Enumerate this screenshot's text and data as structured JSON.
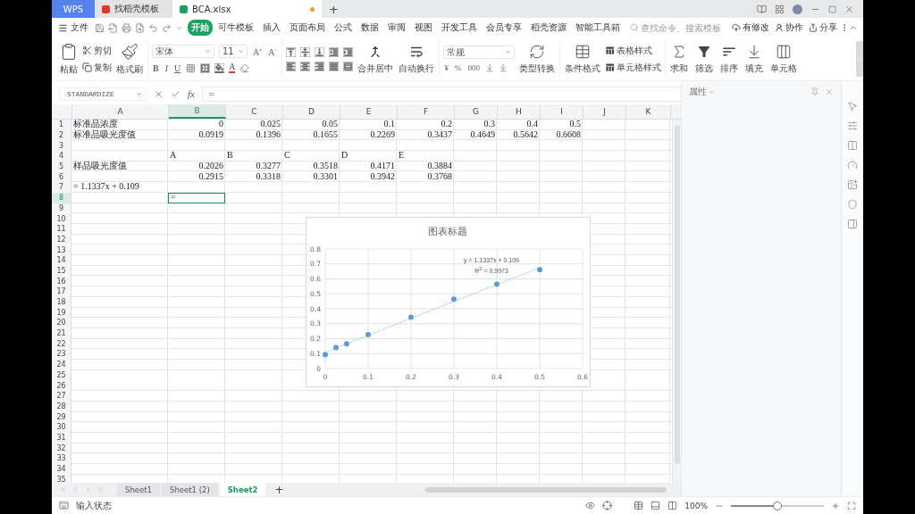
{
  "title_bar": {
    "tabs": [
      {
        "label": "WPS",
        "kind": "home",
        "selected": false,
        "modified": false
      },
      {
        "label": "找稻壳模板",
        "kind": "template",
        "selected": false,
        "modified": false
      },
      {
        "label": "BCA.xlsx",
        "kind": "workbook",
        "selected": true,
        "modified": true
      }
    ],
    "new_tab": "+"
  },
  "menu_bar": {
    "file": "文件",
    "tabs": [
      {
        "label": "开始",
        "selected": true
      },
      {
        "label": "可牛模板",
        "selected": false
      },
      {
        "label": "插入",
        "selected": false
      },
      {
        "label": "页面布局",
        "selected": false
      },
      {
        "label": "公式",
        "selected": false
      },
      {
        "label": "数据",
        "selected": false
      },
      {
        "label": "审阅",
        "selected": false
      },
      {
        "label": "视图",
        "selected": false
      },
      {
        "label": "开发工具",
        "selected": false
      },
      {
        "label": "会员专享",
        "selected": false
      },
      {
        "label": "稻壳资源",
        "selected": false
      },
      {
        "label": "智能工具箱",
        "selected": false
      }
    ],
    "search": {
      "placeholder": "查找命令、搜索模板"
    },
    "actions": [
      {
        "label": "有修改"
      },
      {
        "label": "协作"
      },
      {
        "label": "分享"
      }
    ]
  },
  "ribbon": {
    "paste": "粘贴",
    "cut": "剪切",
    "copy": "复制",
    "format_painter": "格式刷",
    "font_name": "宋体",
    "font_size": "11",
    "size_buttons": [
      "A⁺",
      "A⁻"
    ],
    "styles": [
      "B",
      "I",
      "U"
    ],
    "font_color": "A",
    "merge": "合并居中",
    "wrap": "自动换行",
    "number_format": "常规",
    "number_symbols": [
      "¥",
      "%",
      "000"
    ],
    "convert": "类型转换",
    "conditional_format": "条件格式",
    "table_style": "表格样式",
    "cell_style": "单元格样式",
    "sum": "求和",
    "filter": "筛选",
    "sort": "排序",
    "fill": "填充",
    "cell": "单元格"
  },
  "formula_bar": {
    "name_box": "STANDARDIZE",
    "fx": "fx",
    "value": "="
  },
  "sheet": {
    "columns": [
      {
        "label": "A",
        "selected": false
      },
      {
        "label": "B",
        "selected": true
      },
      {
        "label": "C",
        "selected": false
      },
      {
        "label": "D",
        "selected": false
      },
      {
        "label": "E",
        "selected": false
      },
      {
        "label": "F",
        "selected": false
      },
      {
        "label": "G",
        "selected": false
      },
      {
        "label": "H",
        "selected": false
      },
      {
        "label": "I",
        "selected": false
      },
      {
        "label": "J",
        "selected": false
      },
      {
        "label": "K",
        "selected": false
      }
    ],
    "rows": [
      {
        "label": "1",
        "selected": false,
        "cells": {
          "A": {
            "kind": "text",
            "text": "标准品浓度"
          },
          "B": {
            "kind": "number",
            "text": "0"
          },
          "C": {
            "kind": "number",
            "text": "0.025"
          },
          "D": {
            "kind": "number",
            "text": "0.05"
          },
          "E": {
            "kind": "number",
            "text": "0.1"
          },
          "F": {
            "kind": "number",
            "text": "0.2"
          },
          "G": {
            "kind": "number",
            "text": "0.3"
          },
          "H": {
            "kind": "number",
            "text": "0.4"
          },
          "I": {
            "kind": "number",
            "text": "0.5"
          }
        }
      },
      {
        "label": "2",
        "selected": false,
        "cells": {
          "A": {
            "kind": "text",
            "text": "标准品吸光度值"
          },
          "B": {
            "kind": "number",
            "text": "0.0919"
          },
          "C": {
            "kind": "number",
            "text": "0.1396"
          },
          "D": {
            "kind": "number",
            "text": "0.1655"
          },
          "E": {
            "kind": "number",
            "text": "0.2269"
          },
          "F": {
            "kind": "number",
            "text": "0.3437"
          },
          "G": {
            "kind": "number",
            "text": "0.4649"
          },
          "H": {
            "kind": "number",
            "text": "0.5642"
          },
          "I": {
            "kind": "number",
            "text": "0.6608"
          }
        }
      },
      {
        "label": "3",
        "selected": false
      },
      {
        "label": "4",
        "selected": false,
        "cells": {
          "B": {
            "kind": "text",
            "text": "A"
          },
          "C": {
            "kind": "text",
            "text": "B"
          },
          "D": {
            "kind": "text",
            "text": "C"
          },
          "E": {
            "kind": "text",
            "text": "D"
          },
          "F": {
            "kind": "text",
            "text": "E"
          }
        }
      },
      {
        "label": "5",
        "selected": false,
        "cells": {
          "A": {
            "kind": "text",
            "text": "样品吸光度值"
          },
          "B": {
            "kind": "number",
            "text": "0.2026"
          },
          "C": {
            "kind": "number",
            "text": "0.3277"
          },
          "D": {
            "kind": "number",
            "text": "0.3518"
          },
          "E": {
            "kind": "number",
            "text": "0.4171"
          },
          "F": {
            "kind": "number",
            "text": "0.3884"
          }
        }
      },
      {
        "label": "6",
        "selected": false,
        "cells": {
          "B": {
            "kind": "number",
            "text": "0.2915"
          },
          "C": {
            "kind": "number",
            "text": "0.3318"
          },
          "D": {
            "kind": "number",
            "text": "0.3301"
          },
          "E": {
            "kind": "number",
            "text": "0.3942"
          },
          "F": {
            "kind": "number",
            "text": "0.3768"
          }
        }
      },
      {
        "label": "7",
        "selected": false,
        "cells": {
          "A": {
            "kind": "text",
            "text": "= 1.1337x + 0.109"
          }
        }
      },
      {
        "label": "8",
        "selected": true,
        "cells": {
          "B": {
            "kind": "editing",
            "text": "="
          }
        }
      },
      {
        "label": "9",
        "selected": false
      },
      {
        "label": "10",
        "selected": false
      },
      {
        "label": "11",
        "selected": false
      },
      {
        "label": "12",
        "selected": false
      },
      {
        "label": "13",
        "selected": false
      },
      {
        "label": "14",
        "selected": false
      },
      {
        "label": "15",
        "selected": false
      },
      {
        "label": "16",
        "selected": false
      },
      {
        "label": "17",
        "selected": false
      },
      {
        "label": "18",
        "selected": false
      },
      {
        "label": "19",
        "selected": false
      },
      {
        "label": "20",
        "selected": false
      },
      {
        "label": "21",
        "selected": false
      },
      {
        "label": "22",
        "selected": false
      },
      {
        "label": "23",
        "selected": false
      },
      {
        "label": "24",
        "selected": false
      },
      {
        "label": "25",
        "selected": false
      },
      {
        "label": "26",
        "selected": false
      },
      {
        "label": "27",
        "selected": false
      },
      {
        "label": "28",
        "selected": false
      },
      {
        "label": "29",
        "selected": false
      },
      {
        "label": "30",
        "selected": false
      },
      {
        "label": "31",
        "selected": false
      },
      {
        "label": "32",
        "selected": false
      },
      {
        "label": "33",
        "selected": false
      },
      {
        "label": "34",
        "selected": false
      },
      {
        "label": "35",
        "selected": false
      }
    ]
  },
  "chart": {
    "chart_data": {
      "type": "scatter",
      "title": "图表标题",
      "x": [
        0,
        0.025,
        0.05,
        0.1,
        0.2,
        0.3,
        0.4,
        0.5
      ],
      "series": [
        {
          "color": "#5b9bd5",
          "values": [
            0.0919,
            0.1396,
            0.1655,
            0.2269,
            0.3437,
            0.4649,
            0.5642,
            0.6608
          ]
        },
        {
          "type": "line",
          "line_style": "dotted",
          "color": "#7fb0da",
          "values": [
            0.109,
            0.137,
            0.166,
            0.222,
            0.336,
            0.449,
            0.562,
            0.676
          ]
        }
      ],
      "grid": true,
      "xlim": [
        0,
        0.6
      ],
      "ylim": [
        0,
        0.8
      ],
      "xticks": [
        0,
        0.1,
        0.2,
        0.3,
        0.4,
        0.5,
        0.6
      ],
      "yticks": [
        0,
        0.1,
        0.2,
        0.3,
        0.4,
        0.5,
        0.6,
        0.7,
        0.8
      ],
      "annotations": [
        "y = 1.1337x + 0.109",
        "R$^{2}$ = 0.9973"
      ]
    }
  },
  "properties_panel": {
    "title": "属性"
  },
  "sheet_tabs": [
    {
      "label": "Sheet1",
      "selected": false
    },
    {
      "label": "Sheet1 (2)",
      "selected": false
    },
    {
      "label": "Sheet2",
      "selected": true
    }
  ],
  "new_sheet": "+",
  "status_bar": {
    "mode": "输入状态",
    "zoom": "100%",
    "zoom_slider": {
      "level": 0.5
    }
  }
}
